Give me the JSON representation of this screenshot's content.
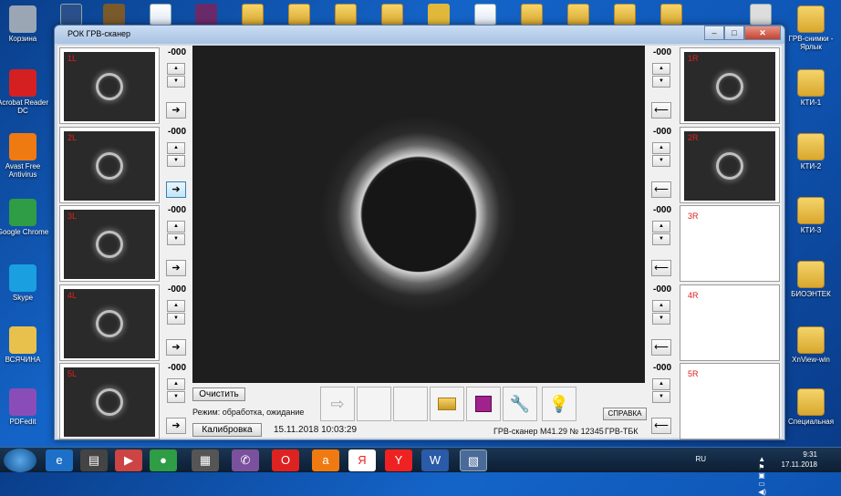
{
  "desktop_icons_left": [
    {
      "label": "Корзина",
      "color": "#9aa6b4"
    },
    {
      "label": "Acrobat Reader DC",
      "color": "#d42020"
    },
    {
      "label": "Avast Free Antivirus",
      "color": "#f07a12"
    },
    {
      "label": "Google Chrome",
      "color": "#2f9c46"
    },
    {
      "label": "Skype",
      "color": "#1a9fe0"
    },
    {
      "label": "ВСЯЧИНА",
      "color": "#e8c14d"
    },
    {
      "label": "PDFedit",
      "color": "#8a4db8"
    }
  ],
  "desktop_icons_right": [
    {
      "label": "ГРВ-снимки - Ярлык"
    },
    {
      "label": "КТИ-1"
    },
    {
      "label": "КТИ-2"
    },
    {
      "label": "КТИ-3"
    },
    {
      "label": "БИОЭНТЕК"
    },
    {
      "label": "XnView-win"
    },
    {
      "label": "Специальная"
    }
  ],
  "window": {
    "title": "РОК ГРВ-сканер",
    "minimize": "–",
    "maximize": "□",
    "close": "✕"
  },
  "left_panels": [
    {
      "label": "1L",
      "value": "-000"
    },
    {
      "label": "2L",
      "value": "-000"
    },
    {
      "label": "3L",
      "value": "-000"
    },
    {
      "label": "4L",
      "value": "-000"
    },
    {
      "label": "5L",
      "value": "-000"
    }
  ],
  "right_panels": [
    {
      "label": "1R",
      "value": "-000"
    },
    {
      "label": "2R",
      "value": "-000"
    },
    {
      "label": "3R",
      "value": "-000"
    },
    {
      "label": "4R",
      "value": "-000"
    },
    {
      "label": "5R",
      "value": "-000"
    }
  ],
  "buttons": {
    "clear": "Очистить",
    "calibrate": "Калибровка",
    "help": "СПРАВКА"
  },
  "status": {
    "mode": "Режим: обработка, ожидание",
    "datetime": "15.11.2018 10:03:29",
    "device": "ГРВ-сканер М41.29 № 12345",
    "variant": "ГРВ-ТБК"
  },
  "taskbar": {
    "lang": "RU",
    "time": "9:31",
    "date": "17.11.2018"
  }
}
